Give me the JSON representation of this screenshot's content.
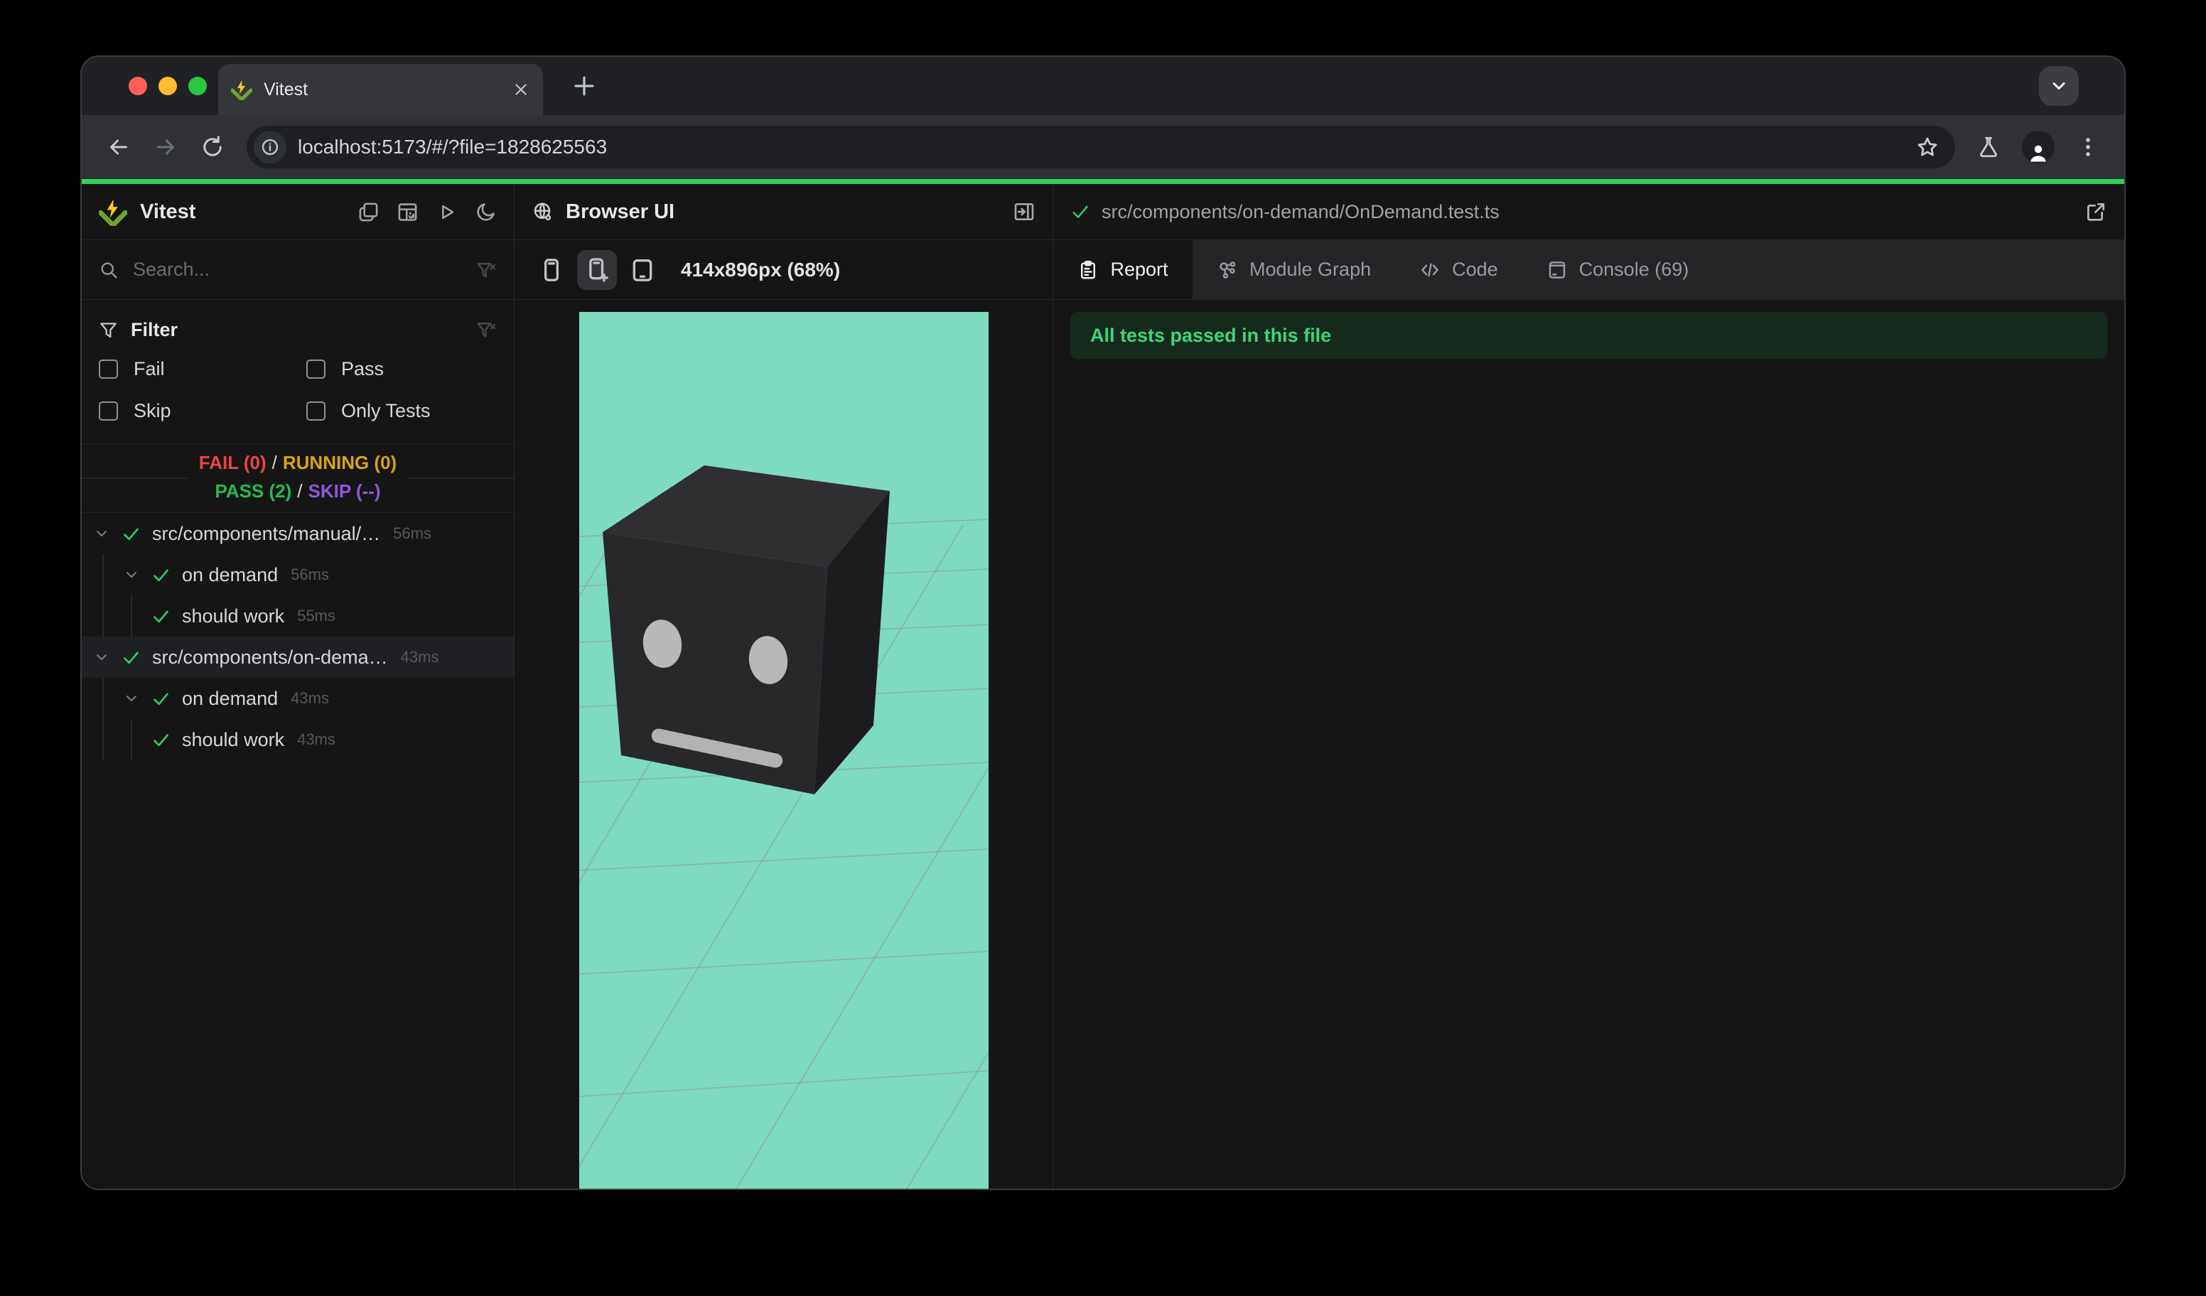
{
  "browser": {
    "tab_title": "Vitest",
    "url": "localhost:5173/#/?file=1828625563"
  },
  "sidebar": {
    "title": "Vitest",
    "search_placeholder": "Search...",
    "filter": {
      "title": "Filter",
      "options": [
        "Fail",
        "Pass",
        "Skip",
        "Only Tests"
      ]
    },
    "status": {
      "fail": "FAIL (0)",
      "running": "RUNNING (0)",
      "pass": "PASS (2)",
      "skip": "SKIP (--)",
      "sep": "/"
    },
    "tree": {
      "rows": [
        {
          "level": 0,
          "label": "src/components/manual/…",
          "duration": "56ms"
        },
        {
          "level": 1,
          "label": "on demand",
          "duration": "56ms"
        },
        {
          "level": 2,
          "label": "should work",
          "duration": "55ms"
        },
        {
          "level": 0,
          "label": "src/components/on-dema…",
          "duration": "43ms"
        },
        {
          "level": 1,
          "label": "on demand",
          "duration": "43ms"
        },
        {
          "level": 2,
          "label": "should work",
          "duration": "43ms"
        }
      ]
    }
  },
  "browser_ui": {
    "title": "Browser UI",
    "resolution": "414x896px (68%)"
  },
  "report": {
    "file_path": "src/components/on-demand/OnDemand.test.ts",
    "tabs": [
      {
        "label": "Report"
      },
      {
        "label": "Module Graph"
      },
      {
        "label": "Code"
      },
      {
        "label": "Console (69)"
      }
    ],
    "banner": "All tests passed in this file"
  },
  "icons": [
    "vitest-logo",
    "favicon",
    "close-icon",
    "new-tab-icon",
    "tab-search-chevron-icon",
    "back-icon",
    "forward-icon",
    "reload-icon",
    "site-info-icon",
    "bookmark-star-icon",
    "flask-icon",
    "profile-avatar-icon",
    "kebab-menu-icon",
    "windows-icon",
    "dashboard-icon",
    "run-icon",
    "moon-icon",
    "search-icon",
    "filter-clear-icon",
    "funnel-icon",
    "chevron-down-icon",
    "check-icon",
    "globe-icon",
    "dock-right-icon",
    "phone-icon",
    "phone-plus-icon",
    "tablet-icon",
    "report-icon",
    "module-graph-icon",
    "code-icon",
    "console-icon",
    "external-link-icon"
  ],
  "colors": {
    "mac_red": "#fe5f57",
    "mac_yellow": "#febc2e",
    "mac_green": "#29c83f",
    "loadbar": "#31d158",
    "fail": "#ef4444",
    "running": "#dca309",
    "pass": "#25ba51",
    "skip": "#8f58d9",
    "check": "#2ecb63",
    "scene_bg": "#7fdbc0",
    "banner_bg": "#152a1d",
    "banner_text": "#3fd578",
    "vitest_yellow": "#fcc72b",
    "vitest_green": "#6da532"
  }
}
